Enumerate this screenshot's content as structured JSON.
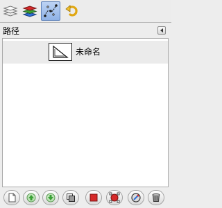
{
  "tabs": [
    {
      "icon": "layers-icon",
      "active": false
    },
    {
      "icon": "channels-icon",
      "active": false
    },
    {
      "icon": "paths-icon",
      "active": true
    },
    {
      "icon": "undo-history-icon",
      "active": false
    }
  ],
  "panel": {
    "title": "路径",
    "menu_icon": "panel-menu-arrow-icon"
  },
  "paths": [
    {
      "name": "未命名",
      "thumbnail_icon": "path-thumbnail-icon"
    }
  ],
  "toolbar": [
    {
      "icon": "new-path-icon"
    },
    {
      "icon": "raise-path-icon"
    },
    {
      "icon": "lower-path-icon"
    },
    {
      "icon": "duplicate-path-icon"
    },
    {
      "icon": "path-to-selection-icon"
    },
    {
      "icon": "selection-to-path-icon"
    },
    {
      "icon": "stroke-path-icon"
    },
    {
      "icon": "delete-path-icon"
    }
  ],
  "colors": {
    "active_tab": "#a9c5ee",
    "red": "#d62a2a",
    "green": "#3aa035"
  }
}
